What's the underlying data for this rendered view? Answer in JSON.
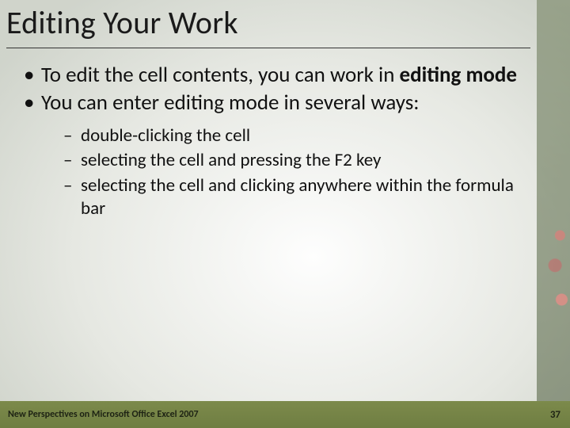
{
  "title": "Editing Your Work",
  "bullets": {
    "b1_pre": "To edit the cell contents, you can work in ",
    "b1_bold": "editing mode",
    "b2": "You can enter editing mode in several ways:",
    "sub1": "double-clicking the cell",
    "sub2": "selecting the cell and pressing the F2 key",
    "sub3": "selecting the cell and clicking anywhere within the formula bar"
  },
  "footer": {
    "source": "New Perspectives on Microsoft Office Excel 2007",
    "page": "37"
  }
}
